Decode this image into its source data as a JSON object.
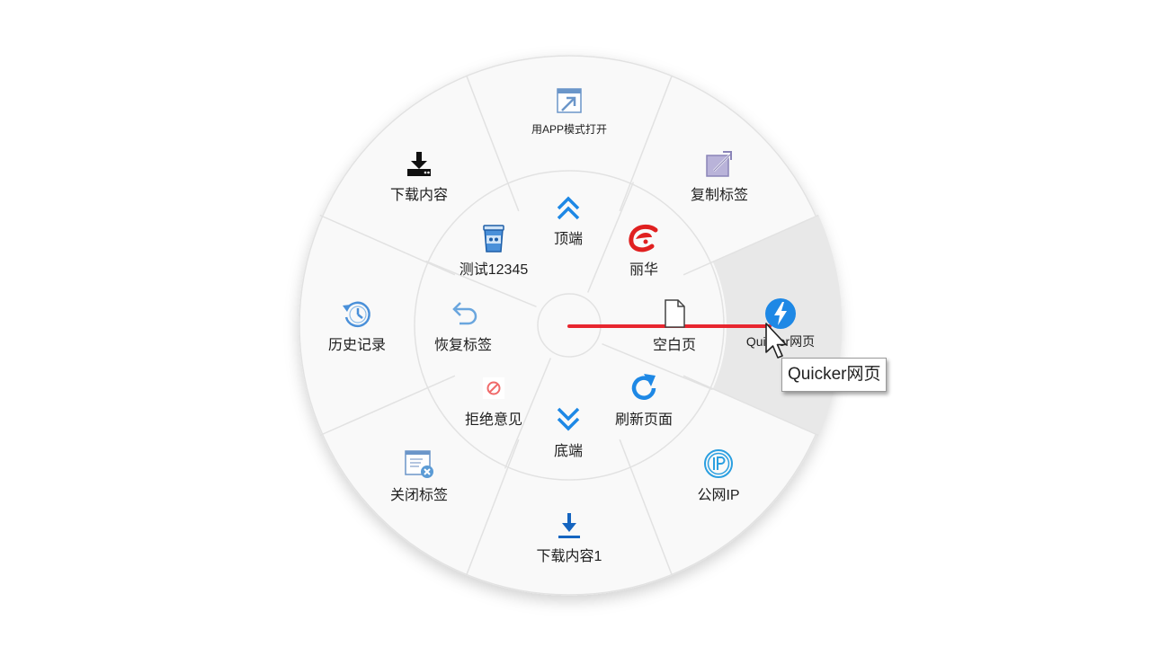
{
  "menu": {
    "outer_ring": [
      {
        "id": "app-mode",
        "label": "用APP模式打开",
        "icon": "open-in-app-icon"
      },
      {
        "id": "copy-tab",
        "label": "复制标签",
        "icon": "copy-tab-icon"
      },
      {
        "id": "quicker-web",
        "label": "Quicker网页",
        "icon": "lightning-icon",
        "active": true
      },
      {
        "id": "public-ip",
        "label": "公网IP",
        "icon": "ip-icon"
      },
      {
        "id": "download-1",
        "label": "下载内容1",
        "icon": "download-arrow-icon"
      },
      {
        "id": "close-tab",
        "label": "关闭标签",
        "icon": "close-tab-icon"
      },
      {
        "id": "history",
        "label": "历史记录",
        "icon": "history-icon"
      },
      {
        "id": "download",
        "label": "下载内容",
        "icon": "download-tray-icon"
      }
    ],
    "inner_ring": [
      {
        "id": "top",
        "label": "顶端",
        "icon": "double-chevron-up-icon"
      },
      {
        "id": "lihua",
        "label": "丽华",
        "icon": "lihua-logo-icon"
      },
      {
        "id": "blank-page",
        "label": "空白页",
        "icon": "blank-page-icon"
      },
      {
        "id": "refresh",
        "label": "刷新页面",
        "icon": "refresh-icon"
      },
      {
        "id": "bottom",
        "label": "底端",
        "icon": "double-chevron-down-icon"
      },
      {
        "id": "reject",
        "label": "拒绝意见",
        "icon": "reject-icon"
      },
      {
        "id": "restore-tab",
        "label": "恢复标签",
        "icon": "undo-arrow-icon"
      },
      {
        "id": "test",
        "label": "测试12345",
        "icon": "cup-icon"
      }
    ]
  },
  "tooltip": {
    "text": "Quicker网页"
  },
  "colors": {
    "accent": "#1e88e5",
    "highlight": "#e8e8e8",
    "gesture_line": "#e8262f"
  }
}
